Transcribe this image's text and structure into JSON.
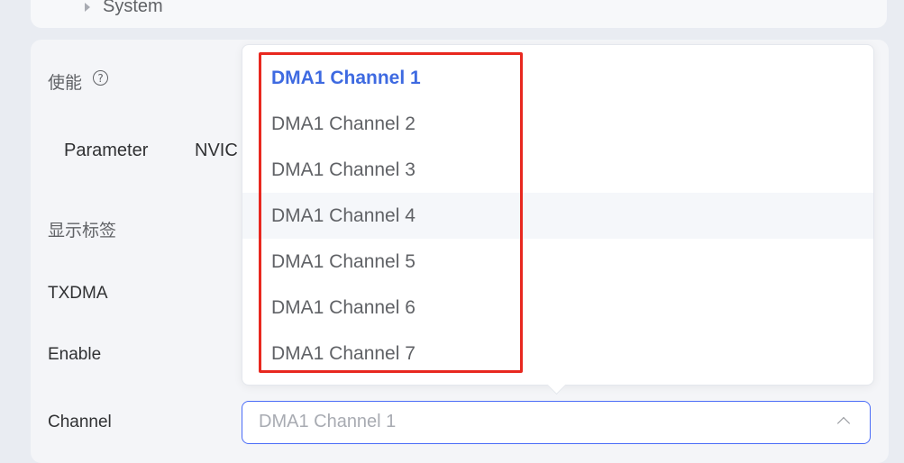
{
  "tree": {
    "item_label": "System"
  },
  "form": {
    "enable_label": "使能",
    "help_icon_glyph": "?",
    "tabs": [
      "Parameter",
      "NVIC"
    ],
    "display_label": "显示标签",
    "txdma_label": "TXDMA",
    "enable_en_label": "Enable",
    "channel_label": "Channel"
  },
  "channel_select": {
    "value": "DMA1 Channel 1",
    "selected_index": 0,
    "hover_index": 3,
    "options": [
      "DMA1 Channel 1",
      "DMA1 Channel 2",
      "DMA1 Channel 3",
      "DMA1 Channel 4",
      "DMA1 Channel 5",
      "DMA1 Channel 6",
      "DMA1 Channel 7"
    ]
  },
  "colors": {
    "accent": "#3e6ae1",
    "highlight": "#e8281f"
  },
  "icons": {
    "tree": "caret-right-icon",
    "help": "question-circle-icon",
    "select": "chevron-up-icon"
  }
}
